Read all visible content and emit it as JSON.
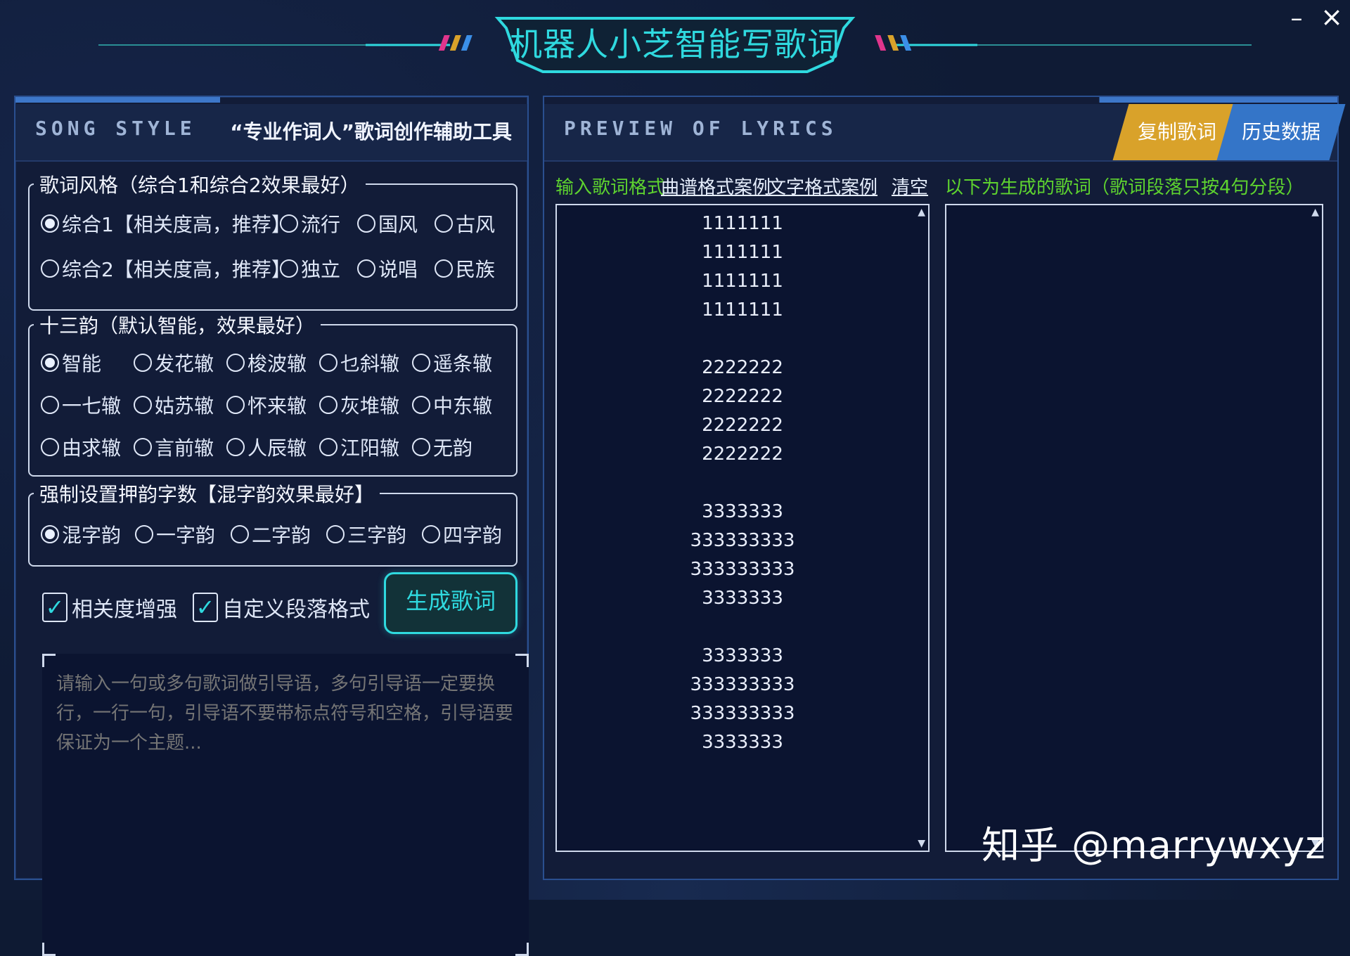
{
  "window": {
    "title": "机器人小芝智能写歌词",
    "minimize_label": "–",
    "close_label": "×"
  },
  "left_panel": {
    "en_title": "SONG STYLE",
    "subtitle": "“专业作词人”歌词创作辅助工具",
    "style_group": {
      "legend": "歌词风格（综合1和综合2效果最好）",
      "options": [
        "综合1【相关度高，推荐】",
        "流行",
        "国风",
        "古风",
        "综合2【相关度高，推荐】",
        "独立",
        "说唱",
        "民族"
      ],
      "selected": "综合1【相关度高，推荐】"
    },
    "rhyme_group": {
      "legend": "十三韵（默认智能，效果最好）",
      "options": [
        "智能",
        "发花辙",
        "梭波辙",
        "乜斜辙",
        "遥条辙",
        "一七辙",
        "姑苏辙",
        "怀来辙",
        "灰堆辙",
        "中东辙",
        "由求辙",
        "言前辙",
        "人辰辙",
        "江阳辙",
        "无韵"
      ],
      "selected": "智能"
    },
    "rhyme_count_group": {
      "legend": "强制设置押韵字数【混字韵效果最好】",
      "options": [
        "混字韵",
        "一字韵",
        "二字韵",
        "三字韵",
        "四字韵"
      ],
      "selected": "混字韵"
    },
    "checkbox_relevance": {
      "label": "相关度增强",
      "checked": true
    },
    "checkbox_custom_paragraph": {
      "label": "自定义段落格式",
      "checked": true
    },
    "generate_label": "生成歌词",
    "guide_placeholder": "请输入一句或多句歌词做引导语，多句引导语一定要换行，一行一句，引导语不要带标点符号和空格，引导语要保证为一个主题..."
  },
  "right_panel": {
    "en_title": "PREVIEW OF LYRICS",
    "copy_label": "复制歌词",
    "history_label": "历史数据",
    "input_format_label": "输入歌词格式",
    "score_example_label": "曲谱格式案例",
    "text_example_label": "文字格式案例",
    "clear_label": "清空",
    "output_hint": "以下为生成的歌词（歌词段落只按4句分段）",
    "input_lines": [
      "1111111",
      "1111111",
      "1111111",
      "1111111",
      "",
      "2222222",
      "2222222",
      "2222222",
      "2222222",
      "",
      "3333333",
      "333333333",
      "333333333",
      "3333333",
      "",
      "3333333",
      "333333333",
      "333333333",
      "3333333"
    ]
  },
  "watermark": "知乎 @marrywxyz",
  "colors": {
    "accent_cyan": "#2fd9df",
    "accent_gold": "#d9a22a",
    "accent_blue": "#3475c8",
    "hint_green": "#5ed32f",
    "background": "#0f1b35"
  }
}
